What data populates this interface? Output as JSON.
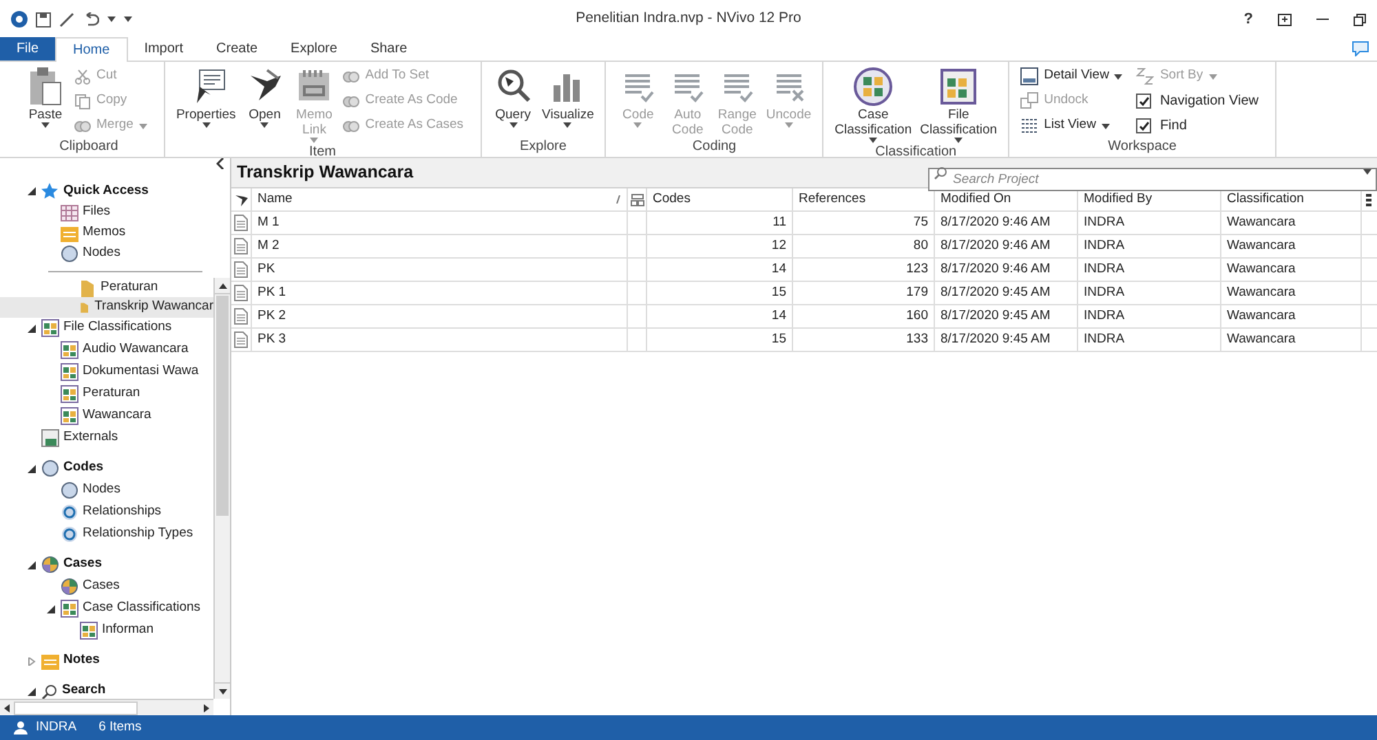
{
  "window": {
    "title": "Penelitian Indra.nvp - NVivo 12 Pro",
    "help": "?"
  },
  "tabs": [
    {
      "label": "File",
      "kind": "file",
      "selected": false
    },
    {
      "label": "Home",
      "kind": "tab",
      "selected": true
    },
    {
      "label": "Import",
      "kind": "tab",
      "selected": false
    },
    {
      "label": "Create",
      "kind": "tab",
      "selected": false
    },
    {
      "label": "Explore",
      "kind": "tab",
      "selected": false
    },
    {
      "label": "Share",
      "kind": "tab",
      "selected": false
    }
  ],
  "ribbon": [
    {
      "group": "Clipboard",
      "items": [
        {
          "kind": "big",
          "label": "Paste",
          "menu": true,
          "disabled": false
        },
        {
          "kind": "stack",
          "items": [
            {
              "kind": "button",
              "label": "Cut",
              "menu": false,
              "disabled": true
            },
            {
              "kind": "button",
              "label": "Copy",
              "menu": false,
              "disabled": true
            },
            {
              "kind": "button",
              "label": "Merge",
              "menu": true,
              "disabled": true
            }
          ]
        }
      ]
    },
    {
      "group": "Item",
      "items": [
        {
          "kind": "big",
          "label": "Properties",
          "menu": true,
          "disabled": false
        },
        {
          "kind": "big",
          "label": "Open",
          "menu": true,
          "disabled": false
        },
        {
          "kind": "big",
          "label": "Memo Link",
          "menu": true,
          "disabled": true
        },
        {
          "kind": "stack",
          "items": [
            {
              "kind": "button",
              "label": "Add To Set",
              "menu": false,
              "disabled": true
            },
            {
              "kind": "button",
              "label": "Create As Code",
              "menu": false,
              "disabled": true
            },
            {
              "kind": "button",
              "label": "Create As Cases",
              "menu": false,
              "disabled": true
            }
          ]
        }
      ]
    },
    {
      "group": "Explore",
      "items": [
        {
          "kind": "big",
          "label": "Query",
          "menu": true,
          "disabled": false
        },
        {
          "kind": "big",
          "label": "Visualize",
          "menu": true,
          "disabled": false
        }
      ]
    },
    {
      "group": "Coding",
      "items": [
        {
          "kind": "big",
          "label": "Code",
          "menu": true,
          "disabled": true
        },
        {
          "kind": "big",
          "label": "Auto Code",
          "menu": false,
          "disabled": true
        },
        {
          "kind": "big",
          "label": "Range Code",
          "menu": false,
          "disabled": true
        },
        {
          "kind": "big",
          "label": "Uncode",
          "menu": true,
          "disabled": true
        }
      ]
    },
    {
      "group": "Classification",
      "items": [
        {
          "kind": "big",
          "label": "Case Classification",
          "menu": true,
          "disabled": false
        },
        {
          "kind": "big",
          "label": "File Classification",
          "menu": true,
          "disabled": false
        }
      ]
    },
    {
      "group": "Workspace",
      "items": [
        {
          "kind": "stack",
          "items": [
            {
              "kind": "button",
              "label": "Detail View",
              "menu": true,
              "disabled": false
            },
            {
              "kind": "button",
              "label": "Undock",
              "menu": false,
              "disabled": true
            },
            {
              "kind": "button",
              "label": "List View",
              "menu": true,
              "disabled": false
            }
          ]
        },
        {
          "kind": "stack",
          "items": [
            {
              "kind": "button",
              "label": "Sort By",
              "menu": true,
              "disabled": true
            },
            {
              "kind": "check",
              "label": "Navigation View",
              "checked": true
            },
            {
              "kind": "check",
              "label": "Find",
              "checked": true
            }
          ]
        }
      ]
    }
  ],
  "quick_access": {
    "label": "Quick Access",
    "expanded": true,
    "children": [
      {
        "label": "Files",
        "kind": "files"
      },
      {
        "label": "Memos",
        "kind": "memos"
      },
      {
        "label": "Nodes",
        "kind": "nodes"
      }
    ]
  },
  "navigation": {
    "partial_children": [
      {
        "label": "Peraturan",
        "kind": "folder",
        "selected": false
      },
      {
        "label": "Transkrip Wawancar",
        "kind": "folder",
        "selected": true
      }
    ],
    "items": [
      {
        "label": "File Classifications",
        "kind": "classification",
        "bold": false,
        "expanded": true,
        "children": [
          {
            "label": "Audio Wawancara",
            "kind": "classification"
          },
          {
            "label": "Dokumentasi Wawa",
            "kind": "classification"
          },
          {
            "label": "Peraturan",
            "kind": "classification"
          },
          {
            "label": "Wawancara",
            "kind": "classification"
          }
        ]
      },
      {
        "label": "Externals",
        "kind": "externals",
        "bold": false
      },
      {
        "label": "Codes",
        "kind": "codes",
        "bold": true,
        "expanded": true,
        "children": [
          {
            "label": "Nodes",
            "kind": "nodes"
          },
          {
            "label": "Relationships",
            "kind": "relationships"
          },
          {
            "label": "Relationship Types",
            "kind": "relationships"
          }
        ]
      },
      {
        "label": "Cases",
        "kind": "cases",
        "bold": true,
        "expanded": true,
        "children": [
          {
            "label": "Cases",
            "kind": "cases"
          },
          {
            "label": "Case Classifications",
            "kind": "classification",
            "expanded": true,
            "children": [
              {
                "label": "Informan",
                "kind": "classification"
              }
            ]
          }
        ]
      },
      {
        "label": "Notes",
        "kind": "memos",
        "bold": true,
        "expanded": false
      },
      {
        "label": "Search",
        "kind": "search",
        "bold": true,
        "expanded": true
      }
    ]
  },
  "content": {
    "title": "Transkrip Wawancara",
    "search": {
      "placeholder": "Search Project"
    },
    "columns": [
      "Name",
      "Codes",
      "References",
      "Modified On",
      "Modified By",
      "Classification"
    ],
    "rows": [
      {
        "name": "M 1",
        "codes": "11",
        "references": "75",
        "modified_on": "8/17/2020 9:46 AM",
        "modified_by": "INDRA",
        "classification": "Wawancara"
      },
      {
        "name": "M 2",
        "codes": "12",
        "references": "80",
        "modified_on": "8/17/2020 9:46 AM",
        "modified_by": "INDRA",
        "classification": "Wawancara"
      },
      {
        "name": "PK",
        "codes": "14",
        "references": "123",
        "modified_on": "8/17/2020 9:46 AM",
        "modified_by": "INDRA",
        "classification": "Wawancara"
      },
      {
        "name": "PK 1",
        "codes": "15",
        "references": "179",
        "modified_on": "8/17/2020 9:45 AM",
        "modified_by": "INDRA",
        "classification": "Wawancara"
      },
      {
        "name": "PK 2",
        "codes": "14",
        "references": "160",
        "modified_on": "8/17/2020 9:45 AM",
        "modified_by": "INDRA",
        "classification": "Wawancara"
      },
      {
        "name": "PK 3",
        "codes": "15",
        "references": "133",
        "modified_on": "8/17/2020 9:45 AM",
        "modified_by": "INDRA",
        "classification": "Wawancara"
      }
    ]
  },
  "status_bar": {
    "user": "INDRA",
    "count": "6 Items"
  }
}
